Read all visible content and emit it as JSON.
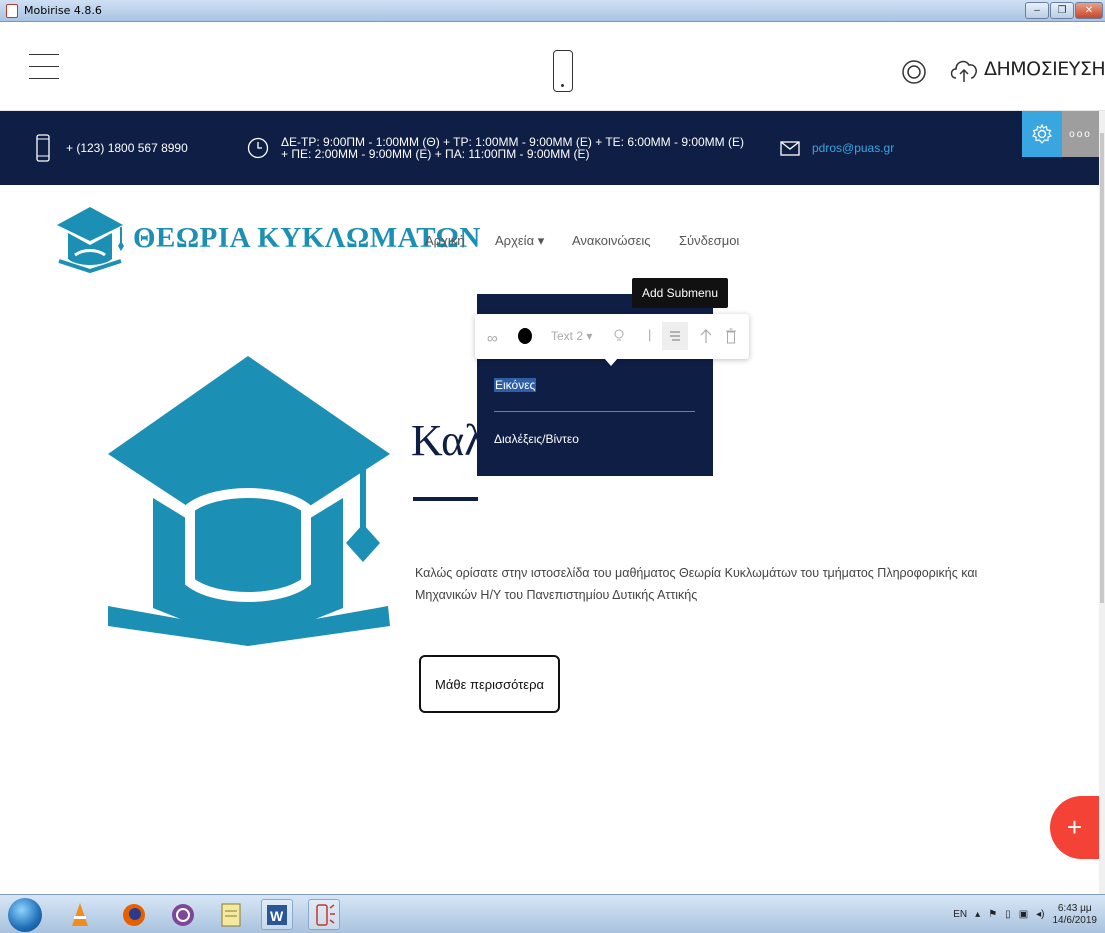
{
  "window": {
    "title": "Mobirise 4.8.6"
  },
  "toolbar": {
    "publish_label": "ΔΗΜΟΣΙΕΥΣΗ"
  },
  "infobar": {
    "phone": "+ (123) 1800 567 8990",
    "hours_line1": "ΔΕ-ΤΡ: 9:00ΠΜ - 1:00ΜΜ (Θ) + ΤΡ: 1:00ΜΜ - 9:00ΜΜ (Ε) + ΤΕ: 6:00ΜΜ - 9:00ΜΜ (Ε)",
    "hours_line2": "+ ΠΕ: 2:00ΜΜ - 9:00ΜΜ (Ε) + ΠΑ: 11:00ΠΜ - 9:00ΜΜ (Ε)",
    "email": "pdros@puas.gr",
    "more_label": "ooo"
  },
  "header": {
    "site_title": "ΘΕΩΡΙΑ ΚΥΚΛΩΜΑΤΩΝ",
    "nav": [
      {
        "label": "Αρχική"
      },
      {
        "label": "Αρχεία ▾"
      },
      {
        "label": "Ανακοινώσεις"
      },
      {
        "label": "Σύνδεσμοι"
      }
    ]
  },
  "dropdown": {
    "items": [
      {
        "label": "Εικόνες"
      },
      {
        "label": "Διαλέξεις/Βίντεο"
      }
    ]
  },
  "edit_toolbar": {
    "link_glyph": "∞",
    "text_style_label": "Text 2 ▾",
    "divider_glyph": "|",
    "tooltip": "Add Submenu"
  },
  "hero": {
    "heading": "Καλ",
    "text": "Καλώς ορίσατε στην ιστοσελίδα του μαθήματος Θεωρία Κυκλωμάτων του τμήματος Πληροφορικής και Μηχανικών Η/Υ του Πανεπιστημίου Δυτικής Αττικής",
    "cta_label": "Μάθε περισσότερα"
  },
  "fab": {
    "label": "+"
  },
  "taskbar": {
    "lang": "EN",
    "time": "6:43 μμ",
    "date": "14/6/2019"
  },
  "colors": {
    "navy": "#0f1e45",
    "teal": "#1b8fb4",
    "accent_blue": "#3aa6e0",
    "fab_red": "#f44336"
  }
}
